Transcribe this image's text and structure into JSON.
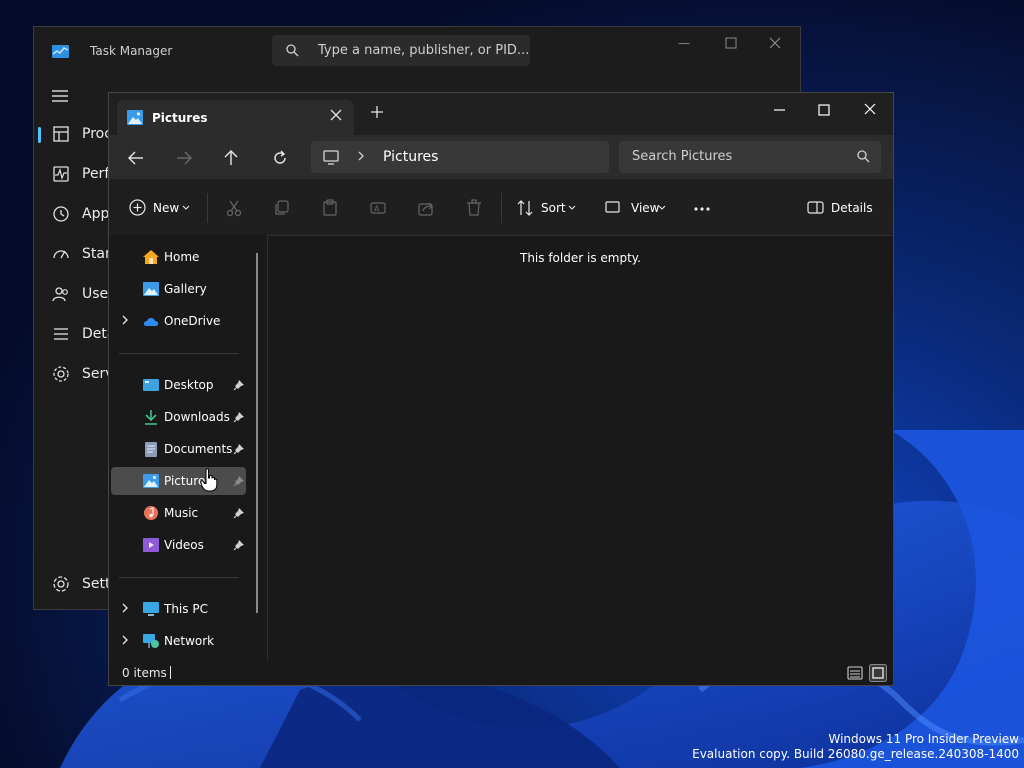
{
  "task_manager": {
    "title": "Task Manager",
    "search_placeholder": "Type a name, publisher, or PID...",
    "nav": [
      {
        "label": "Proc",
        "icon": "processes-icon"
      },
      {
        "label": "Perfo",
        "icon": "performance-icon"
      },
      {
        "label": "App",
        "icon": "app-history-icon"
      },
      {
        "label": "Start",
        "icon": "startup-icon"
      },
      {
        "label": "User",
        "icon": "users-icon"
      },
      {
        "label": "Deta",
        "icon": "details-icon"
      },
      {
        "label": "Serv",
        "icon": "services-icon"
      }
    ],
    "settings_label": "Setti"
  },
  "explorer": {
    "tab_title": "Pictures",
    "address": {
      "location": "Pictures"
    },
    "search_placeholder": "Search Pictures",
    "commands": {
      "new": "New",
      "sort": "Sort",
      "view": "View",
      "details": "Details"
    },
    "sidebar": {
      "top": [
        {
          "label": "Home",
          "icon": "home-icon",
          "expandable": false
        },
        {
          "label": "Gallery",
          "icon": "gallery-icon",
          "expandable": false
        },
        {
          "label": "OneDrive",
          "icon": "onedrive-icon",
          "expandable": true
        }
      ],
      "quick_access": [
        {
          "label": "Desktop",
          "icon": "desktop-icon"
        },
        {
          "label": "Downloads",
          "icon": "downloads-icon"
        },
        {
          "label": "Documents",
          "icon": "documents-icon"
        },
        {
          "label": "Pictures",
          "icon": "pictures-icon",
          "selected": true
        },
        {
          "label": "Music",
          "icon": "music-icon"
        },
        {
          "label": "Videos",
          "icon": "videos-icon"
        }
      ],
      "bottom": [
        {
          "label": "This PC",
          "icon": "this-pc-icon",
          "expandable": true
        },
        {
          "label": "Network",
          "icon": "network-icon",
          "expandable": true
        }
      ]
    },
    "empty_message": "This folder is empty.",
    "status": {
      "item_count": "0 items"
    }
  },
  "watermark": {
    "line1": "Windows 11 Pro Insider Preview",
    "line2": "Evaluation copy. Build 26080.ge_release.240308-1400"
  },
  "colors": {
    "accent": "#4cc2ff",
    "window_bg": "#191919",
    "selection": "#4c4c4c"
  }
}
